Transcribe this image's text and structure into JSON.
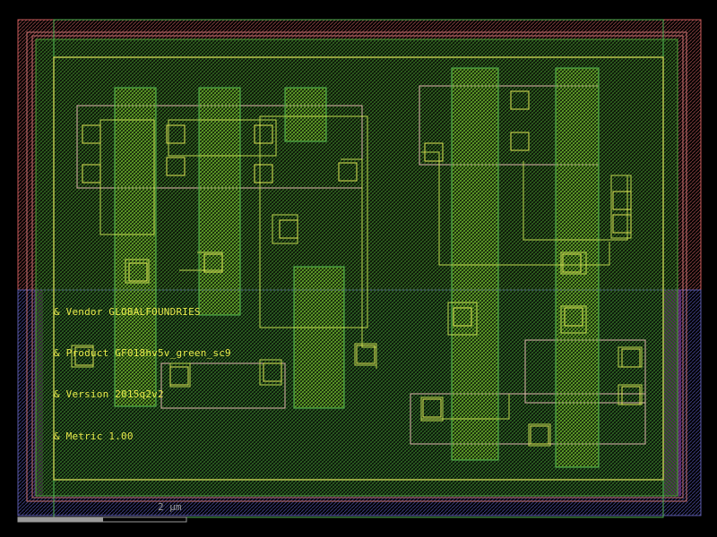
{
  "labels": {
    "vendor": "& Vendor GLOBALFOUNDRIES",
    "product": "& Product GF018hv5v_green_sc9",
    "version": "& Version 2015q2v2",
    "metric": "& Metric 1.00"
  },
  "scale": {
    "text": "2 µm"
  },
  "colors": {
    "background": "#000000",
    "nwell": "#c85a5a",
    "pwell": "#5a5aa8",
    "boundary": "#dede5a",
    "poly": "#4fb04f",
    "metal": "#b8c84a",
    "diffusion": "#d8a8a8",
    "contact": "#d8d850"
  }
}
